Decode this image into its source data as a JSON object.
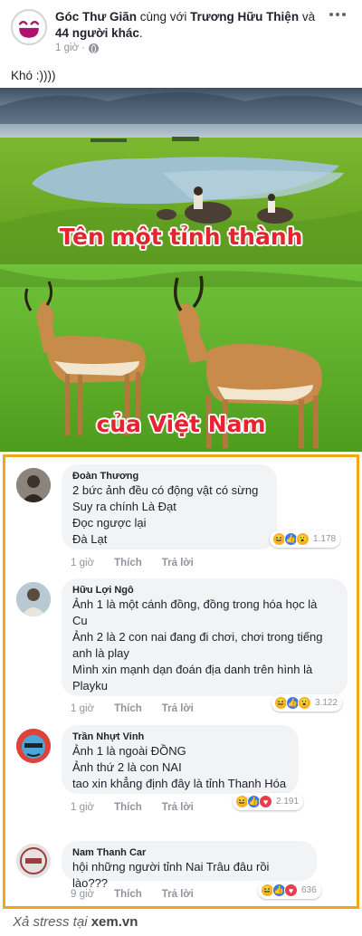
{
  "post": {
    "page_name": "Góc Thư Giãn",
    "with_text": " cùng với ",
    "tagged_name": "Trương Hữu Thiện",
    "and_text": " và",
    "others": "44 người khác",
    "period": ".",
    "time": "1 giờ ·",
    "text": "Khó :))))"
  },
  "image": {
    "caption_top": "Tên một tỉnh thành",
    "caption_bottom": "của Việt Nam"
  },
  "actions": {
    "like": "Thích",
    "reply": "Trả lời"
  },
  "comments": [
    {
      "name": "Đoàn Thương",
      "lines": [
        "2 bức ảnh đều có động vật có sừng",
        "Suy ra chính Là Đạt",
        "Đọc ngược lại",
        "Đà Lạt"
      ],
      "time": "1 giờ",
      "reaction_count": "1.178",
      "reactions": [
        "haha",
        "like",
        "wow"
      ]
    },
    {
      "name": "Hữu Lợi Ngô",
      "lines": [
        "Ảnh 1 là một cánh đồng, đồng trong hóa học là",
        "Cu",
        "Ảnh 2 là 2 con nai đang đi chơi, chơi trong tiếng",
        "anh là play",
        "Mình xin mạnh dạn đoán địa danh trên hình là",
        "Playku"
      ],
      "time": "1 giờ",
      "reaction_count": "3.122",
      "reactions": [
        "haha",
        "like",
        "wow"
      ]
    },
    {
      "name": "Trần Nhựt Vinh",
      "lines": [
        "Ảnh 1 là ngoài ĐỒNG",
        "Ảnh thứ 2 là con NAI",
        "tao xin khẳng định đây là tỉnh Thanh Hóa"
      ],
      "time": "1 giờ",
      "reaction_count": "2.191",
      "reactions": [
        "haha",
        "like",
        "love"
      ]
    },
    {
      "name": "Nam Thanh Car",
      "lines": [
        "hội những người tỉnh Nai Trâu đâu rồi lào???"
      ],
      "time": "9 giờ",
      "reaction_count": "636",
      "reactions": [
        "haha",
        "like",
        "love"
      ]
    }
  ],
  "watermark": {
    "prefix": "Xả stress tại ",
    "site": "xem.vn"
  },
  "colors": {
    "caption_red": "#e6232f",
    "frame_orange": "#f0a818",
    "bubble_gray": "#f2f3f5"
  }
}
